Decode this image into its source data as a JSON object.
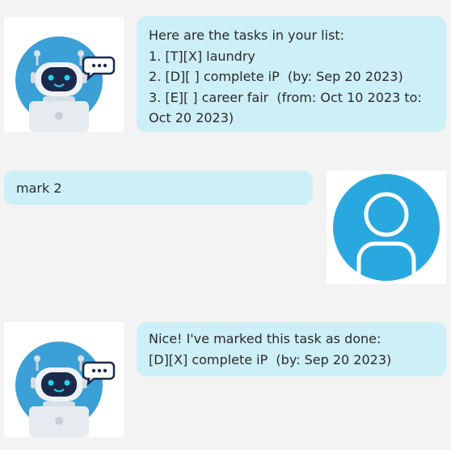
{
  "colors": {
    "background": "#f3f3f3",
    "bubble": "#cdeff7",
    "bot_circle": "#3b9fd6",
    "user_circle": "#29a8e0"
  },
  "messages": [
    {
      "sender": "bot",
      "avatar_icon": "robot-avatar-icon",
      "lines": [
        "Here are the tasks in your list:",
        "1. [T][X] laundry",
        "2. [D][ ] complete iP  (by: Sep 20 2023)",
        "3. [E][ ] career fair  (from: Oct 10 2023 to:",
        "Oct 20 2023)"
      ]
    },
    {
      "sender": "user",
      "avatar_icon": "user-avatar-icon",
      "lines": [
        "mark 2"
      ]
    },
    {
      "sender": "bot",
      "avatar_icon": "robot-avatar-icon",
      "lines": [
        "Nice! I've marked this task as done:",
        "[D][X] complete iP  (by: Sep 20 2023)"
      ]
    }
  ]
}
